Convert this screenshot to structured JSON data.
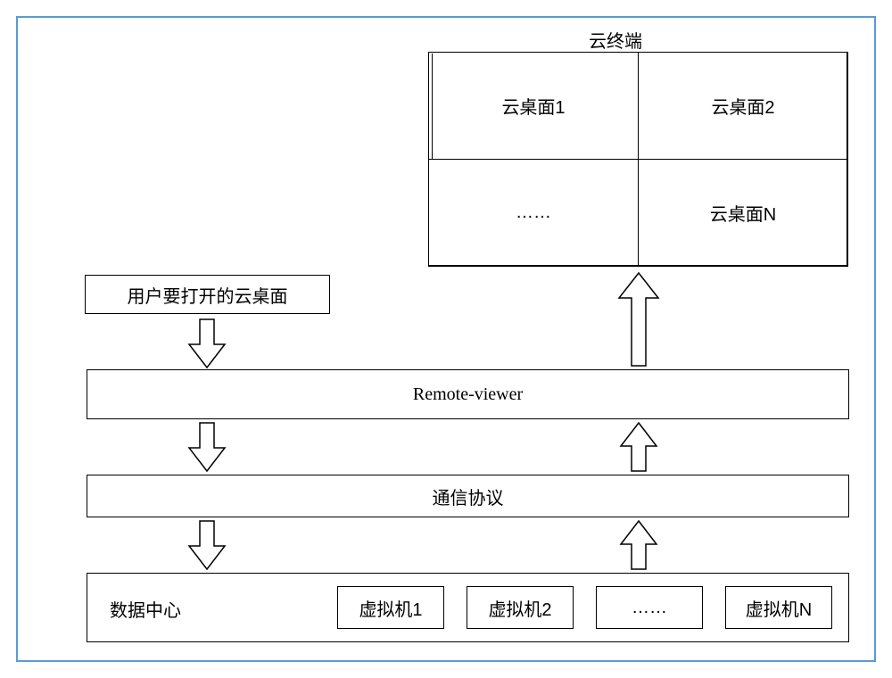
{
  "terminal": {
    "title": "云终端",
    "cells": {
      "c1": "云桌面1",
      "c2": "云桌面2",
      "c3": "……",
      "c4": "云桌面N"
    }
  },
  "user_request": "用户要打开的云桌面",
  "remote_viewer": "Remote-viewer",
  "protocol": "通信协议",
  "datacenter": {
    "label": "数据中心",
    "vm1": "虚拟机1",
    "vm2": "虚拟机2",
    "ellipsis": "……",
    "vmN": "虚拟机N"
  }
}
